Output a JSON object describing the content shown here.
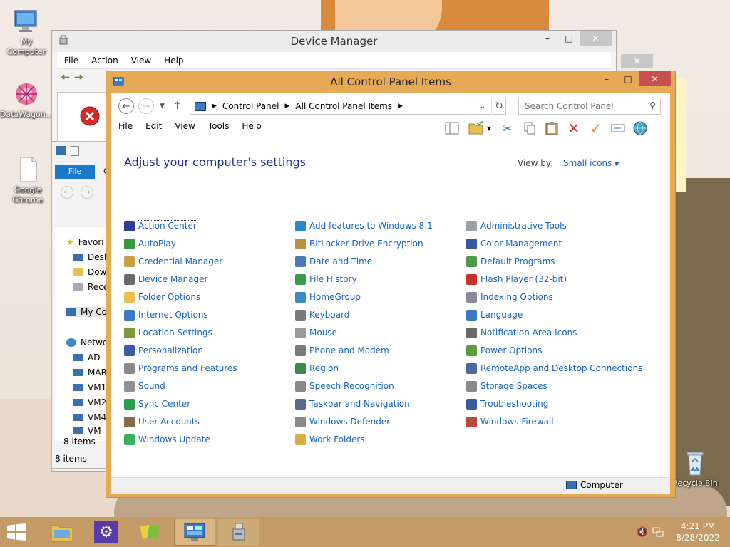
{
  "desktop": {
    "icons": [
      {
        "label": "My Computer",
        "icon": "computer-icon"
      },
      {
        "label": "DataWagon...",
        "icon": "datawagon-icon"
      },
      {
        "label": "Google Chrome",
        "icon": "file-icon"
      },
      {
        "label": "Recycle Bin",
        "icon": "recycle-bin-icon"
      }
    ]
  },
  "device_manager": {
    "title": "Device Manager",
    "menu": [
      "File",
      "Action",
      "View",
      "Help"
    ]
  },
  "explorer": {
    "ribbon_file": "File",
    "ribbon_partial": "C",
    "nav": {
      "favorites": "Favori",
      "desktop": "Desk",
      "downloads": "Dow",
      "recent": "Rece",
      "my_computer": "My Co",
      "network": "Netwo",
      "hosts": [
        "AD",
        "MAR",
        "VM1",
        "VM2",
        "VM4",
        "VM"
      ]
    },
    "status_inner": "8 items",
    "status_outer": "8 items"
  },
  "control_panel": {
    "title": "All Control Panel Items",
    "address": {
      "root": "Control Panel",
      "current": "All Control Panel Items"
    },
    "search_placeholder": "Search Control Panel",
    "menu": [
      "File",
      "Edit",
      "View",
      "Tools",
      "Help"
    ],
    "heading": "Adjust your computer's settings",
    "view_by_label": "View by:",
    "view_by_value": "Small icons",
    "columns": [
      [
        {
          "label": "Action Center",
          "color": "#2c3e9e"
        },
        {
          "label": "AutoPlay",
          "color": "#3a9a3a"
        },
        {
          "label": "Credential Manager",
          "color": "#c8a040"
        },
        {
          "label": "Device Manager",
          "color": "#6a6a6a"
        },
        {
          "label": "Folder Options",
          "color": "#e8c050"
        },
        {
          "label": "Internet Options",
          "color": "#3a7ac8"
        },
        {
          "label": "Location Settings",
          "color": "#7a9a3a"
        },
        {
          "label": "Personalization",
          "color": "#3a5aa8"
        },
        {
          "label": "Programs and Features",
          "color": "#8a8a8a"
        },
        {
          "label": "Sound",
          "color": "#909090"
        },
        {
          "label": "Sync Center",
          "color": "#2aa04a"
        },
        {
          "label": "User Accounts",
          "color": "#8a6a4a"
        },
        {
          "label": "Windows Update",
          "color": "#3ab060"
        }
      ],
      [
        {
          "label": "Add features to Windows 8.1",
          "color": "#2a8ac8"
        },
        {
          "label": "BitLocker Drive Encryption",
          "color": "#b89040"
        },
        {
          "label": "Date and Time",
          "color": "#4a7ab8"
        },
        {
          "label": "File History",
          "color": "#3a9a4a"
        },
        {
          "label": "HomeGroup",
          "color": "#3a8ac0"
        },
        {
          "label": "Keyboard",
          "color": "#7a7a7a"
        },
        {
          "label": "Mouse",
          "color": "#9a9a9a"
        },
        {
          "label": "Phone and Modem",
          "color": "#7a7a7a"
        },
        {
          "label": "Region",
          "color": "#3a8a4a"
        },
        {
          "label": "Speech Recognition",
          "color": "#8a8a8a"
        },
        {
          "label": "Taskbar and Navigation",
          "color": "#5a6a8a"
        },
        {
          "label": "Windows Defender",
          "color": "#8a8a8a"
        },
        {
          "label": "Work Folders",
          "color": "#d8b040"
        }
      ],
      [
        {
          "label": "Administrative Tools",
          "color": "#9aa0a8"
        },
        {
          "label": "Color Management",
          "color": "#3a5aa0"
        },
        {
          "label": "Default Programs",
          "color": "#4a9a4a"
        },
        {
          "label": "Flash Player (32-bit)",
          "color": "#c8302a"
        },
        {
          "label": "Indexing Options",
          "color": "#8a8a9a"
        },
        {
          "label": "Language",
          "color": "#3a7ac0"
        },
        {
          "label": "Notification Area Icons",
          "color": "#6a6a6a"
        },
        {
          "label": "Power Options",
          "color": "#5aa03a"
        },
        {
          "label": "RemoteApp and Desktop Connections",
          "color": "#4a6aa0"
        },
        {
          "label": "Storage Spaces",
          "color": "#8a8a8a"
        },
        {
          "label": "Troubleshooting",
          "color": "#3a5a9a"
        },
        {
          "label": "Windows Firewall",
          "color": "#b84a3a"
        }
      ]
    ],
    "status_computer": "Computer"
  },
  "taskbar": {
    "time": "4:21 PM",
    "date": "8/28/2022",
    "buttons": [
      {
        "icon": "file-explorer-icon"
      },
      {
        "icon": "settings-gear-icon"
      },
      {
        "icon": "color-tiles-icon"
      },
      {
        "icon": "control-panel-icon"
      },
      {
        "icon": "device-manager-icon"
      }
    ]
  }
}
